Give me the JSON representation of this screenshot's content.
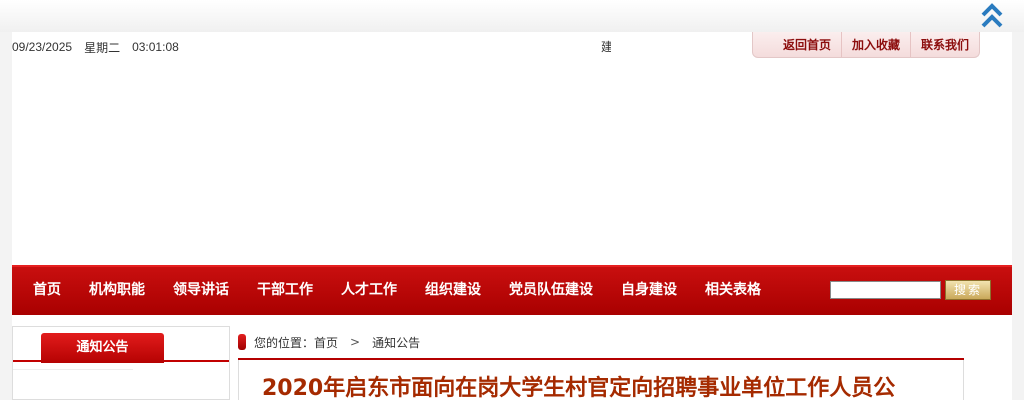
{
  "topbar": {
    "date": "09/23/2025",
    "weekday": "星期二",
    "time": "03:01:08",
    "marquee_glyph": "建",
    "links": [
      "返回首页",
      "加入收藏",
      "联系我们"
    ]
  },
  "nav": {
    "items": [
      "首页",
      "机构职能",
      "领导讲话",
      "干部工作",
      "人才工作",
      "组织建设",
      "党员队伍建设",
      "自身建设",
      "相关表格"
    ],
    "search_button": "搜索",
    "search_placeholder": ""
  },
  "sidebar": {
    "title": "通知公告"
  },
  "breadcrumb": {
    "prefix": "您的位置：",
    "home": "首页",
    "separator": ">",
    "current": "通知公告"
  },
  "article": {
    "title": "2020年启东市面向在岗大学生村官定向招聘事业单位工作人员公"
  },
  "colors": {
    "nav_red": "#b80000",
    "title_color": "#a52a00",
    "link_color": "#8c0d0d",
    "scroll_icon": "#2a7bbf"
  }
}
